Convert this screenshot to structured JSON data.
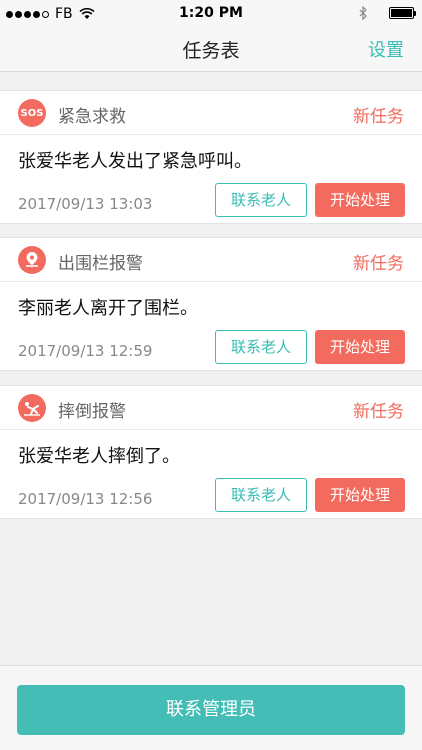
{
  "status_bar": {
    "carrier": "FB",
    "time": "1:20 PM"
  },
  "nav": {
    "title": "任务表",
    "settings": "设置"
  },
  "tasks": [
    {
      "icon": "sos-icon",
      "icon_text": "SOS",
      "type": "紧急求救",
      "status": "新任务",
      "message": "张爱华老人发出了紧急呼叫。",
      "time": "2017/09/13  13:03",
      "contact_label": "联系老人",
      "handle_label": "开始处理"
    },
    {
      "icon": "location-pin-icon",
      "type": "出围栏报警",
      "status": "新任务",
      "message": "李丽老人离开了围栏。",
      "time": "2017/09/13  12:59",
      "contact_label": "联系老人",
      "handle_label": "开始处理"
    },
    {
      "icon": "fall-person-icon",
      "type": "摔倒报警",
      "status": "新任务",
      "message": "张爱华老人摔倒了。",
      "time": "2017/09/13  12:56",
      "contact_label": "联系老人",
      "handle_label": "开始处理"
    }
  ],
  "footer": {
    "contact_admin": "联系管理员"
  },
  "colors": {
    "accent": "#3bbdb6",
    "alert": "#f26b5e"
  }
}
